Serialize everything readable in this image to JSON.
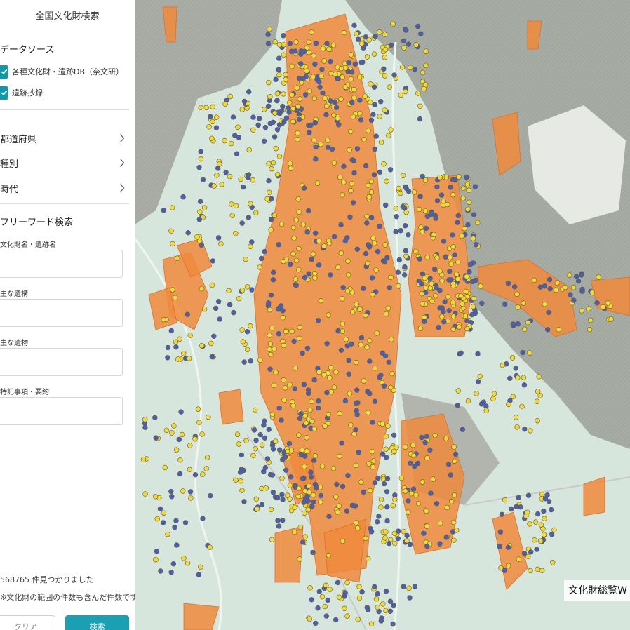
{
  "sidebar": {
    "title": "全国文化財検索",
    "data_source": {
      "heading": "データソース",
      "options": [
        {
          "label": "各種文化財・遺跡DB（奈文研）",
          "checked": true
        },
        {
          "label": "遺跡抄録",
          "checked": true
        }
      ]
    },
    "filters": [
      {
        "label": "都道府県",
        "icon": "chevron-right-icon"
      },
      {
        "label": "種別",
        "icon": "chevron-right-icon"
      },
      {
        "label": "時代",
        "icon": "chevron-right-icon"
      }
    ],
    "freeword": {
      "heading": "フリーワード検索",
      "fields": [
        {
          "label": "文化財名・遺跡名",
          "value": ""
        },
        {
          "label": "主な遺構",
          "value": ""
        },
        {
          "label": "主な遺物",
          "value": ""
        },
        {
          "label": "特記事項・要約",
          "value": ""
        }
      ]
    },
    "result_count": "568765 件見つかりました",
    "result_note": "※文化財の範囲の件数も含んだ件数です",
    "clear_label": "クリア",
    "search_label": "検索"
  },
  "map": {
    "label": "文化財総覧W",
    "colors": {
      "lowland": "#d6e6dd",
      "mountain": "#a7aca5",
      "area_fill": "#f08a3c",
      "marker_blue": "#4b5eb5",
      "marker_yellow": "#f2d93b",
      "accent": "#1497a8"
    }
  }
}
